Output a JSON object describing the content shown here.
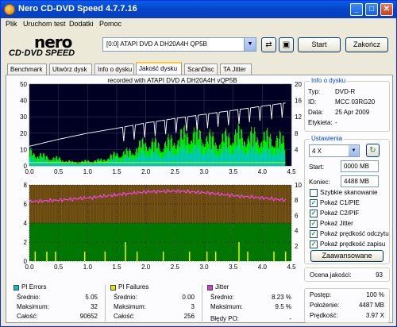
{
  "window": {
    "title": "Nero CD-DVD Speed 4.7.7.16",
    "minimize": "_",
    "maximize": "□",
    "close": "✕"
  },
  "menu": [
    "Plik",
    "Uruchom test",
    "Dodatki",
    "Pomoc"
  ],
  "logo": {
    "brand": "nero",
    "subtitle": "CD·DVD SPEED"
  },
  "toolbar": {
    "drive": "[0:0]   ATAPI DVD A  DH20A4H QP5B",
    "start": "Start",
    "stop": "Zakończ"
  },
  "tabs": [
    "Benchmark",
    "Utwórz dysk",
    "Info o dysku",
    "Jakość dysku",
    "ScanDisc",
    "TA Jitter"
  ],
  "active_tab": "Jakość dysku",
  "chart_top": {
    "caption": "recorded with ATAPI   DVD A  DH20A4H    vQP5B",
    "y_left_ticks": [
      "50",
      "40",
      "30",
      "20",
      "10",
      "0"
    ],
    "y_right_ticks": [
      "20",
      "16",
      "12",
      "8",
      "4"
    ],
    "x_ticks": [
      "0.0",
      "0.5",
      "1.0",
      "1.5",
      "2.0",
      "2.5",
      "3.0",
      "3.5",
      "4.0",
      "4.5"
    ]
  },
  "chart_bottom": {
    "y_left_ticks": [
      "8",
      "6",
      "4",
      "2",
      "0"
    ],
    "y_right_ticks": [
      "10",
      "8",
      "6",
      "4",
      "2"
    ],
    "x_ticks": [
      "0.0",
      "0.5",
      "1.0",
      "1.5",
      "2.0",
      "2.5",
      "3.0",
      "3.5",
      "4.0",
      "4.5"
    ]
  },
  "chart_data": [
    {
      "type": "area",
      "x_unit": "GB",
      "xlim": [
        0,
        4.5
      ],
      "ylim_left": [
        0,
        50
      ],
      "ylim_right": [
        0,
        20
      ],
      "series": [
        {
          "name": "PI Errors",
          "x": [
            0.0,
            0.25,
            0.5,
            0.75,
            1.0,
            1.25,
            1.5,
            1.75,
            2.0,
            2.25,
            2.5,
            2.75,
            3.0,
            3.25,
            3.5,
            3.75,
            4.0,
            4.25,
            4.4
          ],
          "values": [
            12,
            8,
            6,
            3,
            4,
            5,
            10,
            12,
            20,
            17,
            22,
            28,
            25,
            20,
            27,
            25,
            24,
            23,
            20
          ]
        },
        {
          "name": "Read speed",
          "x": [
            0.0,
            0.5,
            1.0,
            1.5,
            2.0,
            2.5,
            3.0,
            3.5,
            4.0,
            4.4
          ],
          "values": [
            4.8,
            6.5,
            8.0,
            9.2,
            10.5,
            11.6,
            12.6,
            13.6,
            14.6,
            15.4
          ]
        }
      ],
      "colors": {
        "bars": "#00ff00",
        "speed": "#ffffff",
        "background": "#000022",
        "line": "#ffff00"
      }
    },
    {
      "type": "line",
      "x_unit": "GB",
      "xlim": [
        0,
        4.5
      ],
      "ylim_left": [
        0,
        8
      ],
      "ylim_right": [
        0,
        10
      ],
      "series": [
        {
          "name": "Jitter",
          "x": [
            0.0,
            0.5,
            1.0,
            1.5,
            2.0,
            2.5,
            3.0,
            3.5,
            4.0,
            4.4
          ],
          "values": [
            7.8,
            8.0,
            8.3,
            8.7,
            9.1,
            9.2,
            9.0,
            8.6,
            8.3,
            8.0
          ]
        },
        {
          "name": "PI Failures",
          "x": [
            0.1,
            0.3,
            0.45,
            0.95,
            1.3,
            1.65,
            1.85,
            2.3,
            2.75,
            3.05,
            3.2,
            3.6,
            3.75,
            4.2,
            4.4
          ],
          "values": [
            1,
            1,
            1,
            1,
            1,
            2,
            1,
            1,
            1,
            1,
            1,
            2,
            1,
            1,
            1
          ]
        }
      ],
      "colors": {
        "jitter": "#ff40ff",
        "failures": "#ffff00",
        "band_low": "#007700",
        "band_high": "#6b4a10"
      }
    }
  ],
  "disc_info": {
    "heading": "Info o dysku",
    "type_label": "Typ:",
    "type": "DVD-R",
    "id_label": "ID:",
    "id": "MCC 03RG20",
    "date_label": "Data:",
    "date": "25 Apr 2009",
    "label_label": "Etykieta:",
    "label": "-"
  },
  "settings": {
    "heading": "Ustawienia",
    "speed": "4 X",
    "start_label": "Start:",
    "start": "0000 MB",
    "end_label": "Koniec:",
    "end": "4488 MB",
    "quick_scan": "Szybkie skanowanie",
    "show_c1": "Pokaż C1/PIE",
    "show_c2": "Pokaż C2/PIF",
    "show_jitter": "Pokaż Jitter",
    "show_read": "Pokaż prędkość odczytu",
    "show_write": "Pokaż prędkość zapisu",
    "advanced": "Zaawansowane"
  },
  "quality": {
    "label": "Ocena jakości:",
    "value": "93"
  },
  "progress": {
    "progress_label": "Postęp:",
    "progress_value": "100 %",
    "position_label": "Położenie:",
    "position_value": "4487 MB",
    "speed_label": "Prędkość:",
    "speed_value": "3.97 X"
  },
  "pi_errors": {
    "heading": "PI Errors",
    "avg_label": "Średnio:",
    "avg": "5.05",
    "max_label": "Maksimum:",
    "max": "32",
    "total_label": "Całość:",
    "total": "90652",
    "color": "#00c8c8"
  },
  "pi_failures": {
    "heading": "PI Failures",
    "avg_label": "Średnio:",
    "avg": "0.00",
    "max_label": "Maksimum:",
    "max": "3",
    "total_label": "Całość:",
    "total": "256",
    "color": "#e8e800"
  },
  "jitter": {
    "heading": "Jitter",
    "avg_label": "Średnio:",
    "avg": "8.23 %",
    "max_label": "Maksimum:",
    "max": "9.5 %",
    "po_label": "Błędy PO:",
    "po": "-",
    "color": "#d040d0"
  }
}
